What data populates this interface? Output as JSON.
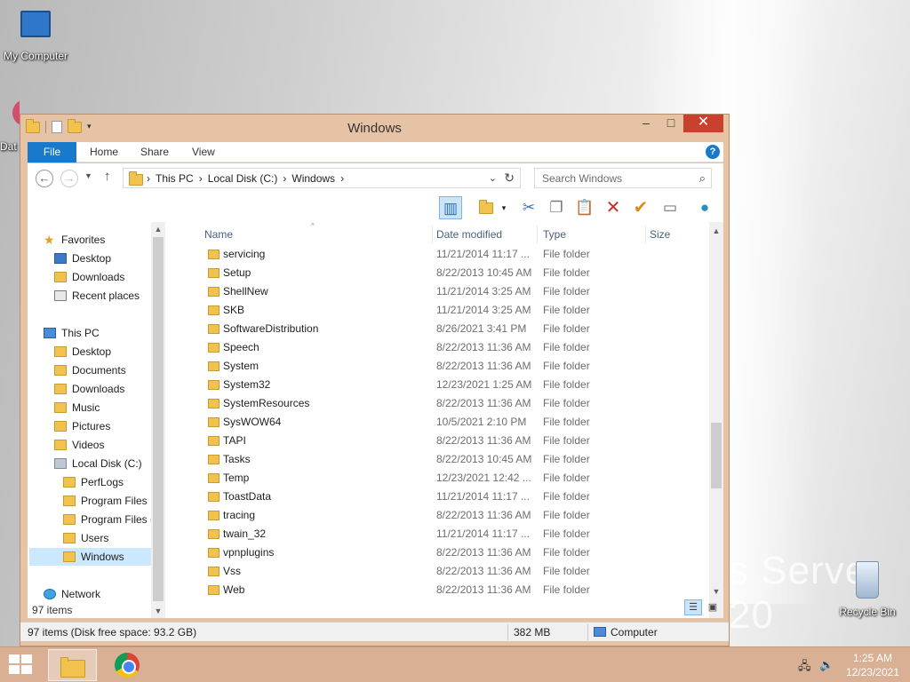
{
  "desktop": {
    "icons": [
      {
        "label": "My Computer"
      },
      {
        "label": "Dat"
      },
      {
        "label": "Recycle Bin"
      }
    ],
    "wallpaper_text": "s Server 20"
  },
  "window": {
    "title": "Windows",
    "buttons": {
      "minimize": "–",
      "maximize": "□",
      "close": "✕"
    }
  },
  "ribbon": {
    "tabs": [
      "File",
      "Home",
      "Share",
      "View"
    ],
    "help": "?"
  },
  "address": {
    "crumbs": [
      "This PC",
      "Local Disk (C:)",
      "Windows"
    ],
    "search_placeholder": "Search Windows"
  },
  "nav_pane": {
    "items": [
      {
        "label": "Favorites",
        "icon": "star-icon"
      },
      {
        "label": "Desktop",
        "icon": "desktop-icon"
      },
      {
        "label": "Downloads",
        "icon": "downloads-icon"
      },
      {
        "label": "Recent places",
        "icon": "recent-places-icon"
      },
      {
        "label": "This PC",
        "icon": "pc-icon"
      },
      {
        "label": "Desktop",
        "icon": "desktop-icon"
      },
      {
        "label": "Documents",
        "icon": "documents-icon"
      },
      {
        "label": "Downloads",
        "icon": "downloads-icon"
      },
      {
        "label": "Music",
        "icon": "music-icon"
      },
      {
        "label": "Pictures",
        "icon": "pictures-icon"
      },
      {
        "label": "Videos",
        "icon": "videos-icon"
      },
      {
        "label": "Local Disk (C:)",
        "icon": "disk-icon"
      },
      {
        "label": "PerfLogs",
        "icon": "folder-icon"
      },
      {
        "label": "Program Files",
        "icon": "folder-icon"
      },
      {
        "label": "Program Files (",
        "icon": "folder-icon"
      },
      {
        "label": "Users",
        "icon": "folder-icon"
      },
      {
        "label": "Windows",
        "icon": "folder-icon"
      },
      {
        "label": "Network",
        "icon": "network-icon"
      }
    ]
  },
  "file_list": {
    "columns": [
      "Name",
      "Date modified",
      "Type",
      "Size"
    ],
    "rows": [
      {
        "name": "servicing",
        "date": "11/21/2014 11:17 ...",
        "type": "File folder"
      },
      {
        "name": "Setup",
        "date": "8/22/2013 10:45 AM",
        "type": "File folder"
      },
      {
        "name": "ShellNew",
        "date": "11/21/2014 3:25 AM",
        "type": "File folder"
      },
      {
        "name": "SKB",
        "date": "11/21/2014 3:25 AM",
        "type": "File folder"
      },
      {
        "name": "SoftwareDistribution",
        "date": "8/26/2021 3:41 PM",
        "type": "File folder"
      },
      {
        "name": "Speech",
        "date": "8/22/2013 11:36 AM",
        "type": "File folder"
      },
      {
        "name": "System",
        "date": "8/22/2013 11:36 AM",
        "type": "File folder"
      },
      {
        "name": "System32",
        "date": "12/23/2021 1:25 AM",
        "type": "File folder"
      },
      {
        "name": "SystemResources",
        "date": "8/22/2013 11:36 AM",
        "type": "File folder"
      },
      {
        "name": "SysWOW64",
        "date": "10/5/2021 2:10 PM",
        "type": "File folder"
      },
      {
        "name": "TAPI",
        "date": "8/22/2013 11:36 AM",
        "type": "File folder"
      },
      {
        "name": "Tasks",
        "date": "8/22/2013 10:45 AM",
        "type": "File folder"
      },
      {
        "name": "Temp",
        "date": "12/23/2021 12:42 ...",
        "type": "File folder"
      },
      {
        "name": "ToastData",
        "date": "11/21/2014 11:17 ...",
        "type": "File folder"
      },
      {
        "name": "tracing",
        "date": "8/22/2013 11:36 AM",
        "type": "File folder"
      },
      {
        "name": "twain_32",
        "date": "11/21/2014 11:17 ...",
        "type": "File folder"
      },
      {
        "name": "vpnplugins",
        "date": "8/22/2013 11:36 AM",
        "type": "File folder"
      },
      {
        "name": "Vss",
        "date": "8/22/2013 11:36 AM",
        "type": "File folder"
      },
      {
        "name": "Web",
        "date": "8/22/2013 11:36 AM",
        "type": "File folder"
      }
    ]
  },
  "item_count": "97 items",
  "status": {
    "info": "97 items (Disk free space: 93.2 GB)",
    "size": "382 MB",
    "location": "Computer"
  },
  "taskbar": {
    "time": "1:25 AM",
    "date": "12/23/2021"
  }
}
